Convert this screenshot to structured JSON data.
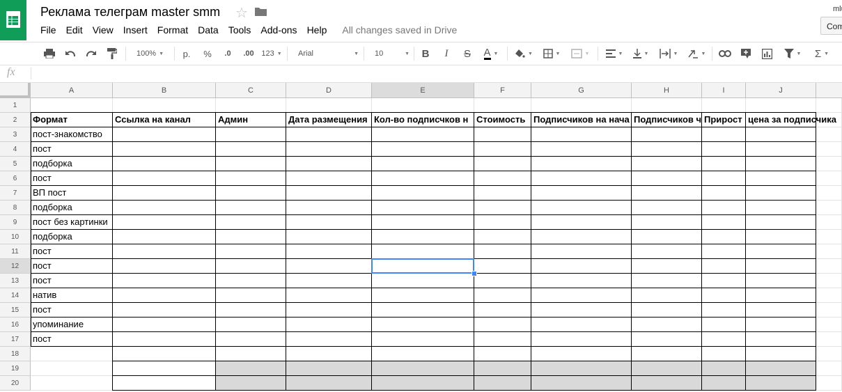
{
  "doc": {
    "title": "Реклама телеграм master smm",
    "saved_status": "All changes saved in Drive",
    "user": "mlu",
    "comments_button": "Comments"
  },
  "menu": [
    "File",
    "Edit",
    "View",
    "Insert",
    "Format",
    "Data",
    "Tools",
    "Add-ons",
    "Help"
  ],
  "toolbar": {
    "zoom": "100%",
    "currency": "р.",
    "percent": "%",
    "decrease_decimals": ".0",
    "increase_decimals": ".00",
    "more_formats": "123",
    "font": "Arial",
    "font_size": "10",
    "bold": "B",
    "italic": "I",
    "strike": "S",
    "text_color_label": "A"
  },
  "formula_bar": {
    "fx": "fx",
    "value": ""
  },
  "columns": [
    "A",
    "B",
    "C",
    "D",
    "E",
    "F",
    "G",
    "H",
    "I",
    "J"
  ],
  "rows": [
    "1",
    "2",
    "3",
    "4",
    "5",
    "6",
    "7",
    "8",
    "9",
    "10",
    "11",
    "12",
    "13",
    "14",
    "15",
    "16",
    "17",
    "18",
    "19",
    "20"
  ],
  "headers": [
    "Формат",
    "Ссылка на канал",
    "Админ",
    "Дата размещения",
    "Кол-во подписчков н",
    "Стоимость",
    "Подписчиков на нача",
    "Подписчиков ч",
    "Прирост",
    "цена за подписчика"
  ],
  "formats": [
    "пост-знакомство",
    "пост",
    "подборка",
    "пост",
    "ВП пост",
    "подборка",
    "пост без картинки",
    "подборка",
    "пост",
    "пост",
    "пост",
    "натив",
    "пост",
    "упоминание",
    "пост"
  ],
  "selected_cell": "E12",
  "colors": {
    "brand": "#0f9d58",
    "selection": "#4285f4",
    "gray_fill": "#d9d9d9"
  }
}
